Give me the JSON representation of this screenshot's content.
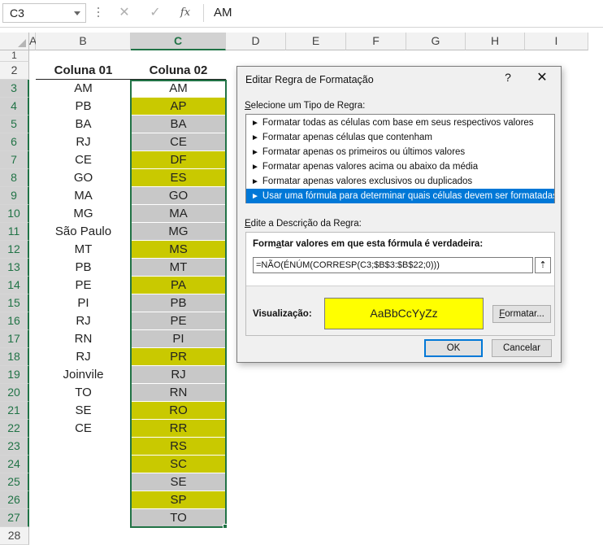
{
  "formula_bar": {
    "name_box": "C3",
    "cancel_glyph": "✕",
    "enter_glyph": "✓",
    "fx_label": "fx",
    "content": "AM"
  },
  "columns": [
    "A",
    "B",
    "C",
    "D",
    "E",
    "F",
    "G",
    "H",
    "I"
  ],
  "selected_column": "C",
  "selected_rows": [
    3,
    4,
    5,
    6,
    7,
    8,
    9,
    10,
    11,
    12,
    13,
    14,
    15,
    16,
    17,
    18,
    19,
    20,
    21,
    22,
    23,
    24,
    25,
    26,
    27
  ],
  "sheet": {
    "header_b": "Coluna 01",
    "header_c": "Coluna 02",
    "col_b": [
      "AM",
      "PB",
      "BA",
      "RJ",
      "CE",
      "GO",
      "MA",
      "MG",
      "São Paulo",
      "MT",
      "PB",
      "PE",
      "PI",
      "RJ",
      "RN",
      "RJ",
      "Joinvile",
      "TO",
      "SE",
      "CE"
    ],
    "col_c": [
      "AM",
      "AP",
      "BA",
      "CE",
      "DF",
      "ES",
      "GO",
      "MA",
      "MG",
      "MS",
      "MT",
      "PA",
      "PB",
      "PE",
      "PI",
      "PR",
      "RJ",
      "RN",
      "RO",
      "RR",
      "RS",
      "SC",
      "SE",
      "SP",
      "TO"
    ],
    "col_c_highlighted": [
      false,
      true,
      false,
      false,
      true,
      true,
      false,
      false,
      false,
      true,
      false,
      true,
      false,
      false,
      false,
      true,
      false,
      false,
      true,
      true,
      true,
      true,
      false,
      true,
      false
    ]
  },
  "colors": {
    "highlight": "#c9c900",
    "normal_fill": "#c8c8c8",
    "selection": "#217346",
    "dialog_accent": "#0078d7",
    "preview_fill": "#ffff00"
  },
  "dialog": {
    "title": "Editar Regra de Formatação",
    "help": "?",
    "close": "✕",
    "rule_type_label_u": "S",
    "rule_type_label": "elecione um Tipo de Regra:",
    "rule_types": [
      "Formatar todas as células com base em seus respectivos valores",
      "Formatar apenas células que contenham",
      "Formatar apenas os primeiros ou últimos valores",
      "Formatar apenas valores acima ou abaixo da média",
      "Formatar apenas valores exclusivos ou duplicados",
      "Usar uma fórmula para determinar quais células devem ser formatadas"
    ],
    "selected_rule_index": 5,
    "arrow_glyph": "►",
    "description_label_u": "E",
    "description_label": "dite a Descrição da Regra:",
    "formula_caption_pre": "Form",
    "formula_caption_u": "a",
    "formula_caption_post": "tar valores em que esta fórmula é verdadeira:",
    "formula": "=NÃO(ÉNÚM(CORRESP(C3;$B$3:$B$22;0)))",
    "collapse_glyph": "⇡",
    "preview_label": "Visualização:",
    "preview_text": "AaBbCcYyZz",
    "format_button_pre": "",
    "format_button_u": "F",
    "format_button_post": "ormatar...",
    "ok_label": "OK",
    "cancel_label": "Cancelar"
  }
}
